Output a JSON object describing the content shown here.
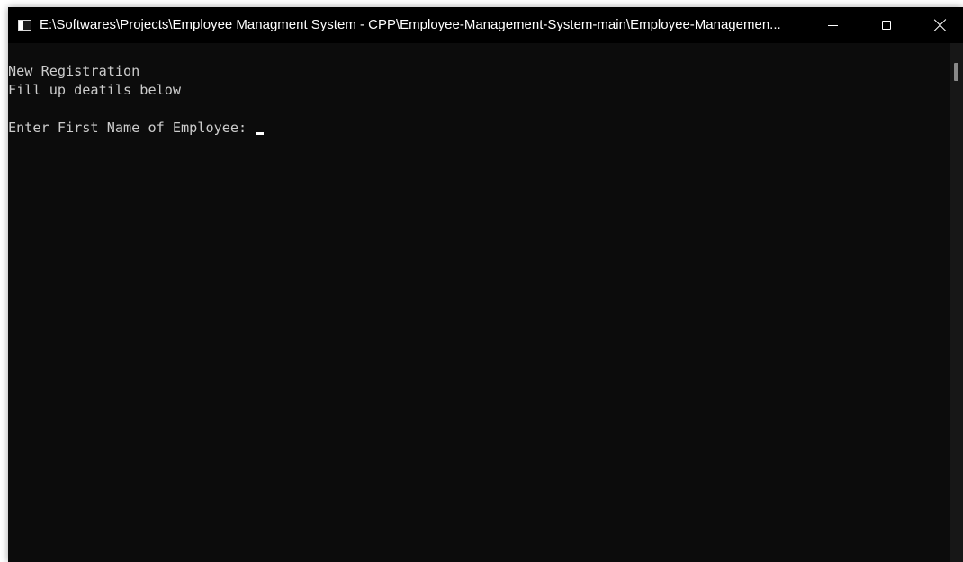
{
  "window": {
    "title": "E:\\Softwares\\Projects\\Employee Managment System - CPP\\Employee-Management-System-main\\Employee-Managemen...",
    "icon": "console-app-icon",
    "controls": {
      "minimize_icon": "minimize-icon",
      "maximize_icon": "maximize-icon",
      "close_icon": "close-icon"
    }
  },
  "console": {
    "lines": [
      "New Registration",
      "Fill up deatils below",
      "Enter First Name of Employee: "
    ],
    "background": "#0c0c0c",
    "text_color": "#cccccc"
  }
}
